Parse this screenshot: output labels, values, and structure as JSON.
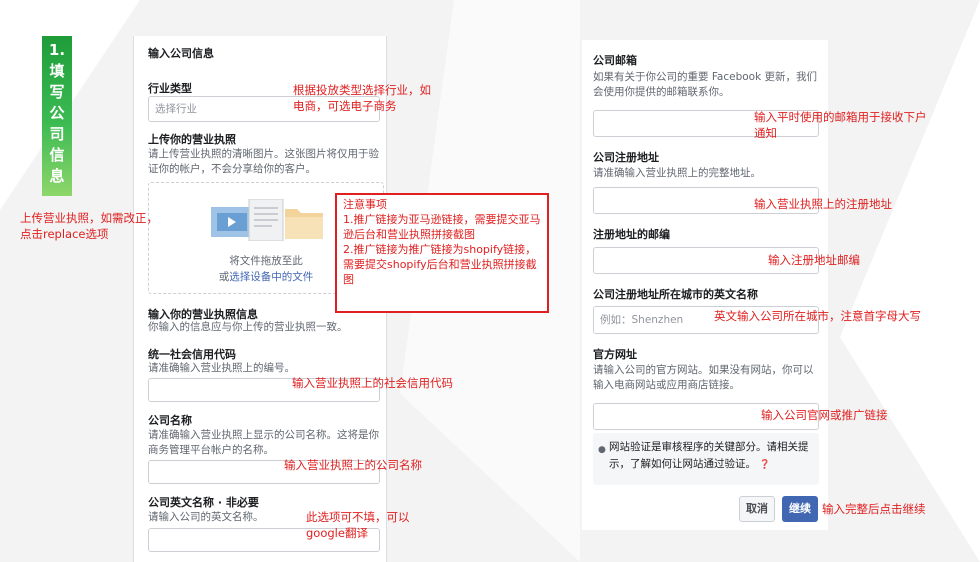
{
  "step": {
    "number": "1.",
    "chars": [
      "填",
      "写",
      "公",
      "司",
      "信",
      "息"
    ]
  },
  "left_form": {
    "header": "输入公司信息",
    "industry": {
      "label": "行业类型",
      "placeholder": "选择行业"
    },
    "license_upload": {
      "label": "上传你的营业执照",
      "help": "请上传营业执照的清晰图片。这张图片将仅用于验证你的帐户，不会分享给你的客户。",
      "drop_text": "将文件拖放至此",
      "or": "或",
      "link": "选择设备中的文件"
    },
    "license_info": {
      "label": "输入你的营业执照信息",
      "help": "你输入的信息应与你上传的营业执照一致。"
    },
    "credit_code": {
      "label": "统一社会信用代码",
      "help": "请准确输入营业执照上的编号。"
    },
    "company_name": {
      "label": "公司名称",
      "help": "请准确输入营业执照上显示的公司名称。这将是你商务管理平台帐户的名称。"
    },
    "company_en_name": {
      "label": "公司英文名称 · 非必要",
      "help": "请输入公司的英文名称。"
    }
  },
  "right_form": {
    "email": {
      "label": "公司邮箱",
      "help": "如果有关于你公司的重要 Facebook 更新，我们会使用你提供的邮箱联系你。"
    },
    "address": {
      "label": "公司注册地址",
      "help": "请准确输入营业执照上的完整地址。"
    },
    "postcode": {
      "label": "注册地址的邮编"
    },
    "city_en": {
      "label": "公司注册地址所在城市的英文名称",
      "placeholder": "例如：Shenzhen"
    },
    "website": {
      "label": "官方网址",
      "help": "请输入公司的官方网站。如果没有网站，你可以输入电商网站或应用商店链接。"
    },
    "info_box": {
      "text": "网站验证是审核程序的关键部分。请相关提示，了解如何让网站通过验证。"
    },
    "cancel_label": "取消",
    "continue_label": "继续"
  },
  "annotations": {
    "industry": "根据投放类型选择行业，如\n电商，可选电子商务",
    "upload": "上传营业执照，如需改正，\n点击replace选项",
    "notice_title": "注意事项",
    "notice_1": "1.推广链接为亚马逊链接，需要提交亚马逊后台和营业执照拼接截图",
    "notice_2": "2.推广链接为推广链接为shopify链接，需要提交shopify后台和营业执照拼接截图",
    "credit_code": "输入营业执照上的社会信用代码",
    "company_name": "输入营业执照上的公司名称",
    "en_name": "此选项可不填，可以\ngoogle翻译",
    "email": "输入平时使用的邮箱用于接收下户\n通知",
    "address": "输入营业执照上的注册地址",
    "postcode": "输入注册地址邮编",
    "city": "英文输入公司所在城市，注意首字母大写",
    "website": "输入公司官网或推广链接",
    "continue": "输入完整后点击继续"
  },
  "colors": {
    "annotation": "#e02020",
    "primary_button": "#4267b2",
    "step_bar": "#2aa845"
  },
  "icons": [
    "document-upload-icon",
    "lightbulb-icon",
    "help-question-icon"
  ]
}
